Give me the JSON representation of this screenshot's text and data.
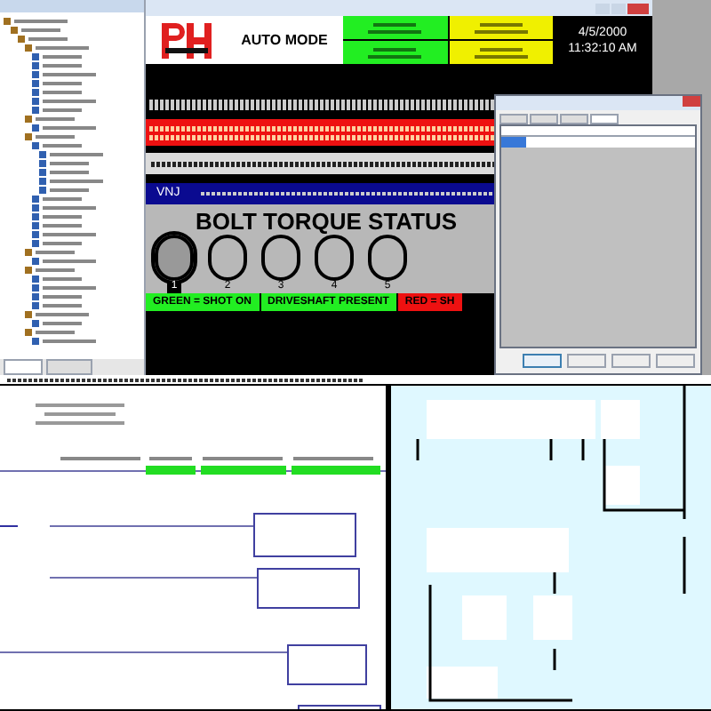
{
  "hmi": {
    "mode": "AUTO MODE",
    "date": "4/5/2000",
    "time": "11:32:10 AM",
    "status_cells": [
      {
        "color": "#22ee22"
      },
      {
        "color": "#f0f000"
      },
      {
        "color": "#22ee22"
      },
      {
        "color": "#f0f000"
      }
    ],
    "line_label": "VNJ",
    "panel_title": "BOLT TORQUE STATUS",
    "bolts": [
      {
        "label": "1",
        "selected": true
      },
      {
        "label": "2",
        "selected": false
      },
      {
        "label": "3",
        "selected": false
      },
      {
        "label": "4",
        "selected": false
      },
      {
        "label": "5",
        "selected": false
      }
    ],
    "legend": [
      {
        "text": "GREEN = SHOT ON",
        "color": "#22ee22"
      },
      {
        "text": "DRIVESHAFT PRESENT",
        "color": "#22ee22"
      },
      {
        "text": "RED = SH",
        "color": "#ee1111"
      }
    ]
  },
  "tree": {
    "items": [
      {
        "kind": "folder",
        "children": [
          {
            "kind": "folder",
            "children": [
              {
                "kind": "folder",
                "children": [
                  {
                    "kind": "folder",
                    "children": [
                      {
                        "kind": "item"
                      },
                      {
                        "kind": "item"
                      },
                      {
                        "kind": "item"
                      },
                      {
                        "kind": "item"
                      },
                      {
                        "kind": "item"
                      },
                      {
                        "kind": "item"
                      },
                      {
                        "kind": "item"
                      }
                    ]
                  },
                  {
                    "kind": "folder",
                    "children": [
                      {
                        "kind": "item"
                      }
                    ]
                  },
                  {
                    "kind": "folder",
                    "children": [
                      {
                        "kind": "item",
                        "children": [
                          {
                            "kind": "item"
                          },
                          {
                            "kind": "item"
                          },
                          {
                            "kind": "item"
                          },
                          {
                            "kind": "item"
                          },
                          {
                            "kind": "item"
                          }
                        ]
                      },
                      {
                        "kind": "item"
                      },
                      {
                        "kind": "item"
                      },
                      {
                        "kind": "item"
                      },
                      {
                        "kind": "item"
                      },
                      {
                        "kind": "item"
                      },
                      {
                        "kind": "item"
                      }
                    ]
                  },
                  {
                    "kind": "folder",
                    "children": [
                      {
                        "kind": "item"
                      }
                    ]
                  },
                  {
                    "kind": "folder",
                    "children": [
                      {
                        "kind": "item"
                      },
                      {
                        "kind": "item"
                      },
                      {
                        "kind": "item"
                      },
                      {
                        "kind": "item"
                      }
                    ]
                  },
                  {
                    "kind": "folder",
                    "children": [
                      {
                        "kind": "item"
                      }
                    ]
                  },
                  {
                    "kind": "folder",
                    "children": [
                      {
                        "kind": "item"
                      }
                    ]
                  }
                ]
              }
            ]
          }
        ]
      }
    ]
  },
  "dialog": {
    "tabs": [
      {
        "selected": false
      },
      {
        "selected": false
      },
      {
        "selected": false
      },
      {
        "selected": true
      }
    ]
  }
}
